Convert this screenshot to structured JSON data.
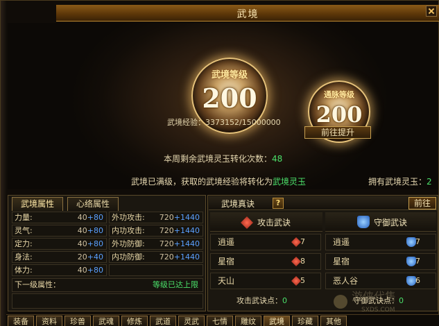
{
  "window": {
    "title": "武境",
    "help": "?"
  },
  "top": {
    "level_label": "武境等级",
    "level_value": "200",
    "meridian_label": "通脉等级",
    "meridian_value": "200",
    "exp_label": "武境经验：",
    "exp_value": "3373152/15000000",
    "goto_upgrade": "前往提升",
    "weekly_prefix": "本周剩余武境灵玉转化次数：",
    "weekly_count": "48",
    "max_text_prefix": "武境已满级，获取的武境经验将转化为",
    "max_text_item": "武境灵玉",
    "owned_label": "拥有武境灵玉：",
    "owned_value": "2"
  },
  "tabs": [
    {
      "label": "武境属性",
      "active": true
    },
    {
      "label": "心络属性",
      "active": false
    }
  ],
  "stats_left": [
    {
      "label": "力量:",
      "base": "40",
      "add": "+80"
    },
    {
      "label": "灵气:",
      "base": "40",
      "add": "+80"
    },
    {
      "label": "定力:",
      "base": "40",
      "add": "+80"
    },
    {
      "label": "身法:",
      "base": "20",
      "add": "+40"
    },
    {
      "label": "体力:",
      "base": "40",
      "add": "+80"
    }
  ],
  "stats_right": [
    {
      "label": "外功攻击:",
      "base": "720",
      "add": "+1440"
    },
    {
      "label": "内功攻击:",
      "base": "720",
      "add": "+1440"
    },
    {
      "label": "外功防御:",
      "base": "720",
      "add": "+1440"
    },
    {
      "label": "内功防御:",
      "base": "720",
      "add": "+1440"
    }
  ],
  "next_level": {
    "label": "下一级属性：",
    "value": "等级已达上限"
  },
  "skills": {
    "title": "武境真诀",
    "goto": "前往",
    "attack_title": "攻击武诀",
    "defense_title": "守御武诀",
    "attack": [
      {
        "name": "逍遥",
        "level": "7"
      },
      {
        "name": "星宿",
        "level": "8"
      },
      {
        "name": "天山",
        "level": "5"
      }
    ],
    "defense": [
      {
        "name": "逍遥",
        "level": "7"
      },
      {
        "name": "星宿",
        "level": "7"
      },
      {
        "name": "恶人谷",
        "level": "6"
      }
    ],
    "attack_points_label": "攻击武诀点：",
    "attack_points": "0",
    "defense_points_label": "守御武诀点：",
    "defense_points": "0"
  },
  "bottom_tabs": [
    {
      "label": "装备"
    },
    {
      "label": "资料"
    },
    {
      "label": "珍兽"
    },
    {
      "label": "武魂"
    },
    {
      "label": "修炼"
    },
    {
      "label": "武道"
    },
    {
      "label": "灵武"
    },
    {
      "label": "七情"
    },
    {
      "label": "雕纹"
    },
    {
      "label": "武境",
      "active": true
    },
    {
      "label": "珍藏"
    },
    {
      "label": "其他"
    }
  ],
  "watermark": "SXDS.COM",
  "colors": {
    "accent": "#c8a050",
    "green": "#4be06a",
    "blue_add": "#5aa0ff"
  }
}
